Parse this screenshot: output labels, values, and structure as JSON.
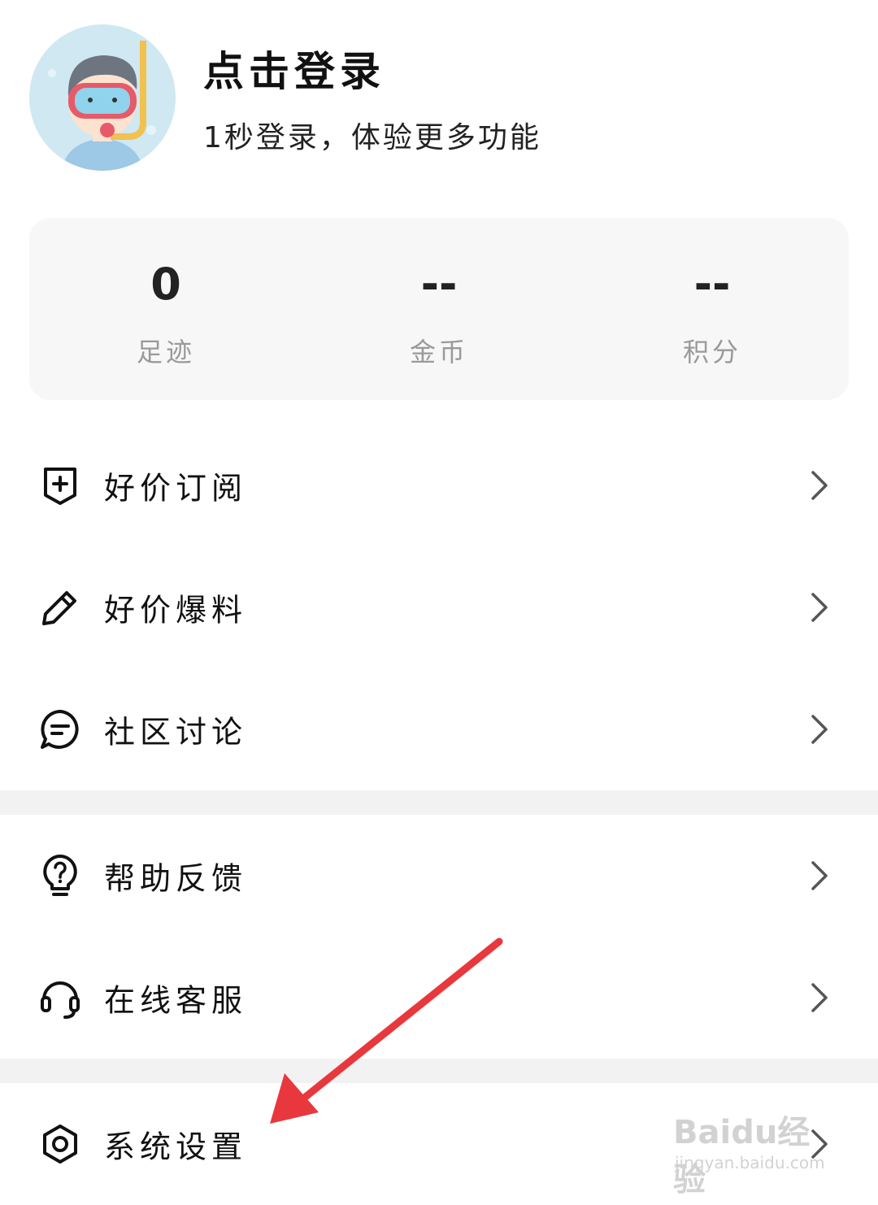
{
  "header": {
    "login_title": "点击登录",
    "login_subtitle": "1秒登录，体验更多功能"
  },
  "stats": [
    {
      "value": "0",
      "label": "足迹"
    },
    {
      "value": "--",
      "label": "金币"
    },
    {
      "value": "--",
      "label": "积分"
    }
  ],
  "menu": {
    "group1": [
      {
        "label": "好价订阅",
        "icon": "subscribe-plus-icon"
      },
      {
        "label": "好价爆料",
        "icon": "pencil-icon"
      },
      {
        "label": "社区讨论",
        "icon": "chat-bubble-icon"
      }
    ],
    "group2": [
      {
        "label": "帮助反馈",
        "icon": "lightbulb-question-icon"
      },
      {
        "label": "在线客服",
        "icon": "headset-icon"
      }
    ],
    "group3": [
      {
        "label": "系统设置",
        "icon": "settings-hexagon-icon"
      }
    ]
  },
  "annotation": {
    "arrow_color": "#e8383d"
  },
  "watermark": {
    "brand": "Baidu经验",
    "url": "jingyan.baidu.com"
  }
}
